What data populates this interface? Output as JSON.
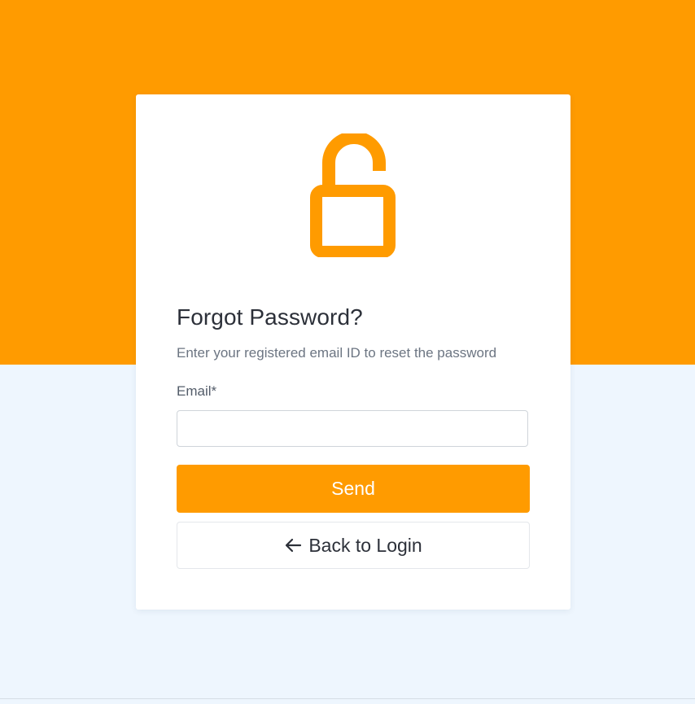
{
  "colors": {
    "accent": "#ff9b00",
    "page_bottom": "#eef6fe",
    "card": "#ffffff",
    "title_text": "#2c3039",
    "muted_text": "#6c7582"
  },
  "card": {
    "icon": "lock-open-icon",
    "title": "Forgot Password?",
    "subtitle": "Enter your registered email ID to reset the password",
    "email": {
      "label": "Email*",
      "value": "",
      "placeholder": ""
    },
    "send_label": "Send",
    "back": {
      "icon": "arrow-left-icon",
      "label": "Back to Login"
    }
  }
}
